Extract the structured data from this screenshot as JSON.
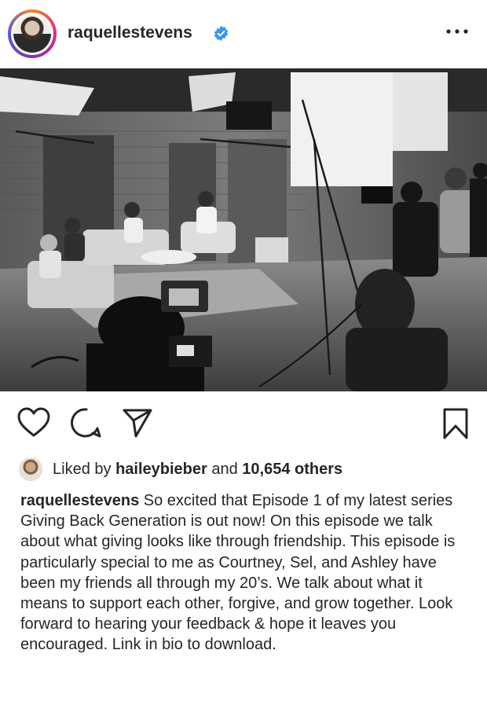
{
  "header": {
    "username": "raquellestevens",
    "verified_icon": "verified-badge-icon",
    "more_icon": "more-options-icon",
    "accent": "#3897f0"
  },
  "post": {
    "image_alt": "Black and white behind-the-scenes photo of four women seated on sofas in a studio with film crew and cameras",
    "actions": {
      "like_icon": "heart-icon",
      "comment_icon": "comment-icon",
      "share_icon": "share-icon",
      "save_icon": "bookmark-icon"
    },
    "likes": {
      "prefix": "Liked by",
      "user": "haileybieber",
      "conjunction": "and",
      "others": "10,654 others"
    },
    "caption": {
      "author": "raquellestevens",
      "text": "So excited that Episode 1 of my latest series Giving Back Generation is out now! On this episode we talk about what giving looks like through friendship. This episode is particularly special to me as Courtney, Sel, and Ashley have been my friends all through my 20’s. We talk about what it means to support each other, forgive, and grow together. Look forward to hearing your feedback & hope it leaves you encouraged. Link in bio to download."
    }
  }
}
